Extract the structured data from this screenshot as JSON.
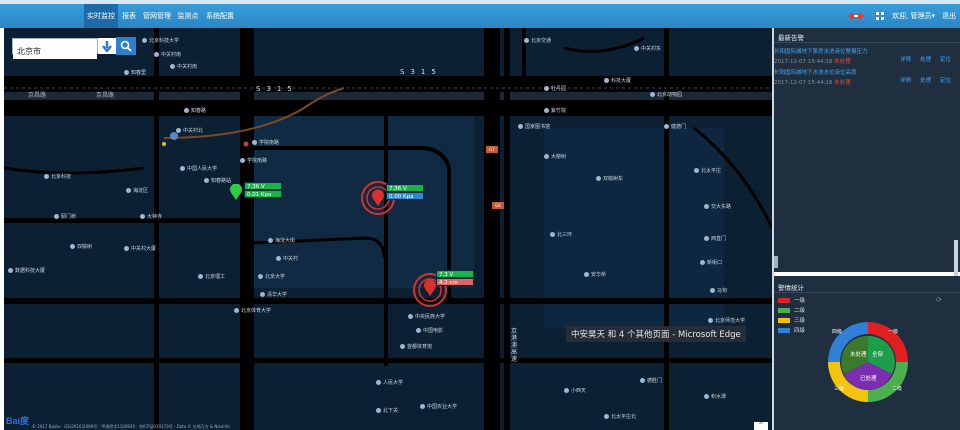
{
  "nav": {
    "items": [
      "实时监控",
      "报表",
      "管网管理",
      "监测点",
      "系统配置"
    ],
    "active_index": 0,
    "welcome": "欢迎, 管理员",
    "logout": "退出"
  },
  "search": {
    "value": "北京市"
  },
  "map": {
    "roads": {
      "north_ring_1": "S315",
      "north_ring_2": "S315",
      "west_road": "京昌路",
      "west_road_2": "京昌路",
      "vertical_road": "京港澳高速"
    },
    "pois": [
      "北京科技大学",
      "中关村南",
      "中关村南",
      "知春里",
      "知春路",
      "中关村北",
      "学院南路",
      "学院南路",
      "北京科技",
      "中国人民大学",
      "海淀区",
      "知春路站",
      "大钟寺",
      "双榆树",
      "数据科技大厦",
      "中关村大厦",
      "北京理工",
      "海淀大街",
      "中关村",
      "北京大学",
      "清华大学",
      "北京体育大学",
      "中央民族大学",
      "中国电影",
      "首都体育馆",
      "人民大学",
      "中国农业大学",
      "北下关",
      "北京交通",
      "科技大厦",
      "中关村东",
      "北京动物园",
      "紫竹院",
      "国家图书馆",
      "大柳树",
      "双榆树东",
      "北太平庄",
      "交大东路",
      "西直门",
      "新街口",
      "马甸",
      "北三环",
      "安华桥",
      "北京师范大学",
      "德胜门",
      "积水潭",
      "小西天",
      "北太平庄北",
      "牡丹园",
      "健德门",
      "蓟门桥"
    ],
    "sensors": [
      {
        "voltage": "7.36 V",
        "pressure": "0.01 Kpa",
        "status": "normal"
      },
      {
        "voltage": "7.36 V",
        "pressure": "0.00 Kpa",
        "status": "alarm"
      },
      {
        "voltage": "7.3 V",
        "pressure": "4.2 cm",
        "status": "alarm"
      }
    ],
    "tooltip": "中安昊天 和 4 个其他页面 - Microsoft Edge",
    "logo": "Bai度",
    "copyright": "© 2017 Baidu - GS(2016)2089号 - 甲测资字1100930 - 京ICP证030173号 - Data © 长地万方 & NavInfo",
    "collapse": "^"
  },
  "alerts": {
    "title": "最新告警",
    "items": [
      {
        "title": "长阳国际城地下泵房水池液位警报压力",
        "time": "2017-12-07 15:44:18",
        "status": "未处理"
      },
      {
        "title": "长阳国际城地下水池水位液位高度",
        "time": "2017-12-07 15:44:18",
        "status": "未处理"
      }
    ],
    "actions": [
      "详情",
      "处理",
      "定位"
    ]
  },
  "stats": {
    "title": "警情统计",
    "levels": [
      {
        "label": "一级",
        "color": "#e02020"
      },
      {
        "label": "二级",
        "color": "#4caf50"
      },
      {
        "label": "三级",
        "color": "#f1c40f"
      },
      {
        "label": "四级",
        "color": "#2f80d6"
      }
    ],
    "donut_labels": [
      "一级",
      "二级",
      "三级",
      "四级"
    ],
    "center_labels": {
      "unhandled": "未处理",
      "all": "全部",
      "handled": "已处理"
    }
  },
  "colors": {
    "nav": "#2b86c4",
    "map_bg": "#0b2033",
    "panel_bg": "#1f2f40",
    "link": "#4ba3f0",
    "alarm": "#e24a3b"
  }
}
